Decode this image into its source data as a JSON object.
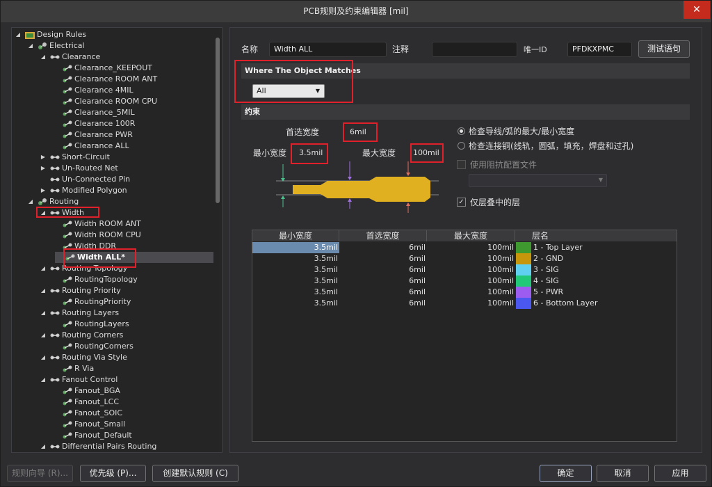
{
  "window": {
    "title": "PCB规则及约束编辑器 [mil]",
    "close_glyph": "✕"
  },
  "tree": {
    "items": [
      {
        "label": "Design Rules",
        "twisty": "◢",
        "icon": "design-rules-icon"
      },
      {
        "label": "Electrical",
        "twisty": "◢",
        "icon": "rule-category-icon"
      },
      {
        "label": "Clearance",
        "twisty": "◢",
        "icon": "rule-type-icon"
      },
      {
        "label": "Clearance_KEEPOUT",
        "twisty": "",
        "icon": "rule-icon"
      },
      {
        "label": "Clearance ROOM ANT",
        "twisty": "",
        "icon": "rule-icon"
      },
      {
        "label": "Clearance 4MIL",
        "twisty": "",
        "icon": "rule-icon"
      },
      {
        "label": "Clearance ROOM CPU",
        "twisty": "",
        "icon": "rule-icon"
      },
      {
        "label": "Clearance_5MIL",
        "twisty": "",
        "icon": "rule-icon"
      },
      {
        "label": "Clearance 100R",
        "twisty": "",
        "icon": "rule-icon"
      },
      {
        "label": "Clearance PWR",
        "twisty": "",
        "icon": "rule-icon"
      },
      {
        "label": "Clearance ALL",
        "twisty": "",
        "icon": "rule-icon"
      },
      {
        "label": "Short-Circuit",
        "twisty": "▶",
        "icon": "rule-type-icon"
      },
      {
        "label": "Un-Routed Net",
        "twisty": "▶",
        "icon": "rule-type-icon"
      },
      {
        "label": "Un-Connected Pin",
        "twisty": "",
        "icon": "rule-type-icon"
      },
      {
        "label": "Modified Polygon",
        "twisty": "▶",
        "icon": "rule-type-icon"
      },
      {
        "label": "Routing",
        "twisty": "◢",
        "icon": "rule-category-icon"
      },
      {
        "label": "Width",
        "twisty": "◢",
        "icon": "rule-type-icon"
      },
      {
        "label": "Width ROOM ANT",
        "twisty": "",
        "icon": "rule-icon"
      },
      {
        "label": "Width ROOM CPU",
        "twisty": "",
        "icon": "rule-icon"
      },
      {
        "label": "Width DDR",
        "twisty": "",
        "icon": "rule-icon"
      },
      {
        "label": "Width ALL*",
        "twisty": "",
        "icon": "rule-icon"
      },
      {
        "label": "Routing Topology",
        "twisty": "◢",
        "icon": "rule-type-icon"
      },
      {
        "label": "RoutingTopology",
        "twisty": "",
        "icon": "rule-icon"
      },
      {
        "label": "Routing Priority",
        "twisty": "◢",
        "icon": "rule-type-icon"
      },
      {
        "label": "RoutingPriority",
        "twisty": "",
        "icon": "rule-icon"
      },
      {
        "label": "Routing Layers",
        "twisty": "◢",
        "icon": "rule-type-icon"
      },
      {
        "label": "RoutingLayers",
        "twisty": "",
        "icon": "rule-icon"
      },
      {
        "label": "Routing Corners",
        "twisty": "◢",
        "icon": "rule-type-icon"
      },
      {
        "label": "RoutingCorners",
        "twisty": "",
        "icon": "rule-icon"
      },
      {
        "label": "Routing Via Style",
        "twisty": "◢",
        "icon": "rule-type-icon"
      },
      {
        "label": "R Via",
        "twisty": "",
        "icon": "rule-icon"
      },
      {
        "label": "Fanout Control",
        "twisty": "◢",
        "icon": "rule-type-icon"
      },
      {
        "label": "Fanout_BGA",
        "twisty": "",
        "icon": "rule-icon"
      },
      {
        "label": "Fanout_LCC",
        "twisty": "",
        "icon": "rule-icon"
      },
      {
        "label": "Fanout_SOIC",
        "twisty": "",
        "icon": "rule-icon"
      },
      {
        "label": "Fanout_Small",
        "twisty": "",
        "icon": "rule-icon"
      },
      {
        "label": "Fanout_Default",
        "twisty": "",
        "icon": "rule-icon"
      },
      {
        "label": "Differential Pairs Routing",
        "twisty": "◢",
        "icon": "rule-type-icon"
      }
    ]
  },
  "rule": {
    "name_label": "名称",
    "name_value": "Width ALL",
    "comment_label": "注释",
    "comment_value": "",
    "uid_label": "唯一ID",
    "uid_value": "PFDKXPMC",
    "test_button": "测试语句"
  },
  "where": {
    "header": "Where The Object Matches",
    "selected": "All",
    "arrow": "▼"
  },
  "constraints": {
    "header": "约束",
    "preferred_label": "首选宽度",
    "preferred_value": "6mil",
    "min_label": "最小宽度",
    "min_value": "3.5mil",
    "max_label": "最大宽度",
    "max_value": "100mil",
    "radio1": "检查导线/弧的最大/最小宽度",
    "radio2": "检查连接铜(线轨，圆弧，填充，焊盘和过孔)",
    "impedance_label": "使用阻抗配置文件",
    "layers_only_label": "仅层叠中的层",
    "check_glyph": "✓",
    "trace_color": "#e0b020"
  },
  "grid": {
    "headers": [
      "最小宽度",
      "首选宽度",
      "最大宽度",
      "层名"
    ],
    "rows": [
      {
        "min": "3.5mil",
        "pref": "6mil",
        "max": "100mil",
        "layer": "1 - Top Layer",
        "color": "#3e9a2e"
      },
      {
        "min": "3.5mil",
        "pref": "6mil",
        "max": "100mil",
        "layer": "2 - GND",
        "color": "#c8960a"
      },
      {
        "min": "3.5mil",
        "pref": "6mil",
        "max": "100mil",
        "layer": "3 - SIG",
        "color": "#5fd0ef"
      },
      {
        "min": "3.5mil",
        "pref": "6mil",
        "max": "100mil",
        "layer": "4 - SIG",
        "color": "#20c878"
      },
      {
        "min": "3.5mil",
        "pref": "6mil",
        "max": "100mil",
        "layer": "5 - PWR",
        "color": "#9c5cf0"
      },
      {
        "min": "3.5mil",
        "pref": "6mil",
        "max": "100mil",
        "layer": "6 - Bottom Layer",
        "color": "#4a58f0"
      }
    ],
    "selected_cell_color": "#6a8aae"
  },
  "footer": {
    "wizard": "规则向导 (R)...",
    "priority": "优先级 (P)...",
    "create_default": "创建默认规则 (C)",
    "ok": "确定",
    "cancel": "取消",
    "apply": "应用"
  }
}
